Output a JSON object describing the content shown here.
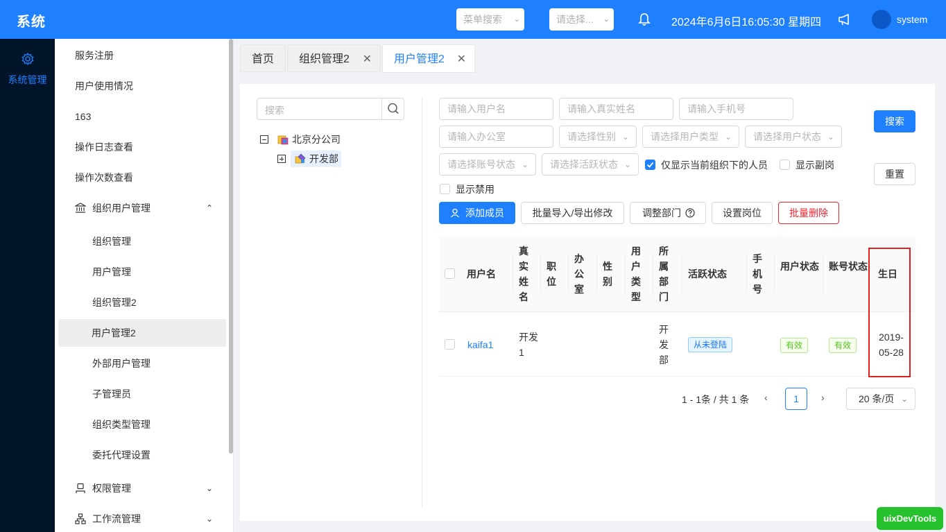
{
  "header": {
    "title": "系统",
    "menu_search_placeholder": "菜单搜索",
    "select_placeholder": "请选择...",
    "datetime": "2024年6月6日16:05:30 星期四",
    "username": "system"
  },
  "rail": {
    "label": "系统管理"
  },
  "menu": {
    "items": [
      "服务注册",
      "用户使用情况",
      "163",
      "操作日志查看",
      "操作次数查看"
    ],
    "org_group": "组织用户管理",
    "org_items": [
      "组织管理",
      "用户管理",
      "组织管理2",
      "用户管理2",
      "外部用户管理",
      "子管理员",
      "组织类型管理",
      "委托代理设置"
    ],
    "perm_group": "权限管理",
    "workflow_group": "工作流管理"
  },
  "tabs": [
    {
      "label": "首页"
    },
    {
      "label": "组织管理2"
    },
    {
      "label": "用户管理2"
    }
  ],
  "tree": {
    "search_placeholder": "搜索",
    "root": "北京分公司",
    "child": "开发部"
  },
  "filters": {
    "username": "请输入用户名",
    "realname": "请输入真实姓名",
    "phone": "请输入手机号",
    "office": "请输入办公室",
    "gender": "请选择性别",
    "user_type": "请选择用户类型",
    "user_status": "请选择用户状态",
    "account_status": "请选择账号状态",
    "active_status": "请选择活跃状态",
    "only_current_org": "仅显示当前组织下的人员",
    "show_deputy": "显示副岗",
    "show_disabled": "显示禁用",
    "search_btn": "搜索",
    "reset_btn": "重置"
  },
  "actions": {
    "add_member": "添加成员",
    "batch_import": "批量导入/导出修改",
    "adjust_dept": "调整部门",
    "set_post": "设置岗位",
    "batch_delete": "批量删除"
  },
  "table": {
    "headers": {
      "username": "用户名",
      "realname": "真实姓名",
      "post": "职位",
      "office": "办公室",
      "gender": "性别",
      "user_type": "用户类型",
      "dept": "所属部门",
      "active": "活跃状态",
      "phone": "手机号",
      "user_status": "用户状态",
      "account_status": "账号状态",
      "birthday": "生日"
    },
    "rows": [
      {
        "username": "kaifa1",
        "realname": "开发1",
        "dept": "开发部",
        "active": "从未登陆",
        "user_status": "有效",
        "account_status": "有效",
        "birthday": "2019-05-28"
      }
    ]
  },
  "pagination": {
    "info": "1 - 1条 / 共 1 条",
    "current": "1",
    "page_size": "20 条/页"
  },
  "devtools": "uixDevTools"
}
